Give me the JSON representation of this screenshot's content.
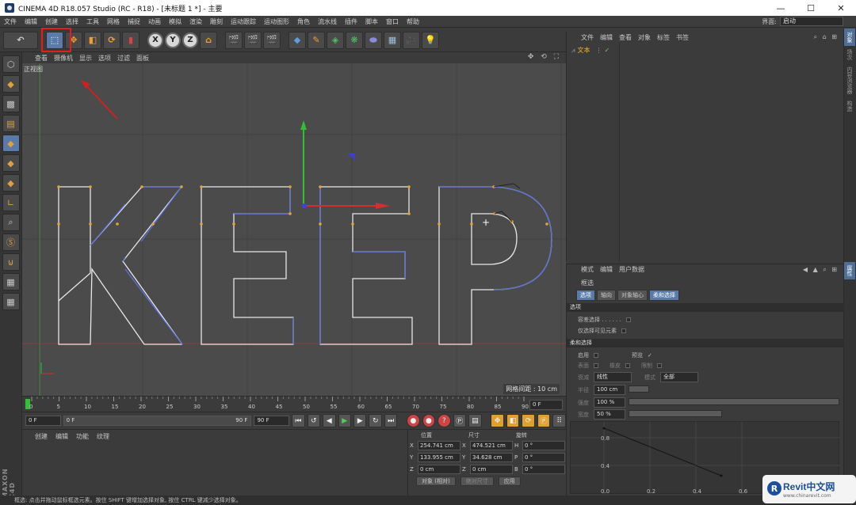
{
  "window": {
    "title": "CINEMA 4D R18.057 Studio (RC - R18) - [未标题 1 *] - 主要",
    "minimize": "—",
    "maximize": "☐",
    "close": "✕"
  },
  "menubar": {
    "items": [
      "文件",
      "编辑",
      "创建",
      "选择",
      "工具",
      "网格",
      "捕捉",
      "动画",
      "模拟",
      "渲染",
      "雕刻",
      "运动跟踪",
      "运动图形",
      "角色",
      "流水线",
      "插件",
      "脚本",
      "窗口",
      "帮助"
    ],
    "layout_label": "界面:",
    "layout_value": "启动"
  },
  "viewport": {
    "menu": [
      "查看",
      "摄像机",
      "显示",
      "选项",
      "过滤",
      "面板"
    ],
    "title": "正视图",
    "grid_note": "网格间距 : 10 cm",
    "icons": "✥ ⟲ ⛶"
  },
  "timeline": {
    "ticks": [
      "0",
      "5",
      "10",
      "15",
      "20",
      "25",
      "30",
      "35",
      "40",
      "45",
      "50",
      "55",
      "60",
      "65",
      "70",
      "75",
      "80",
      "85",
      "90"
    ],
    "current_frame": "0 F",
    "start": "0 F",
    "range_start": "0 F",
    "range_end": "90 F",
    "end": "90 F"
  },
  "material": {
    "tabs": [
      "创建",
      "编辑",
      "功能",
      "纹理"
    ]
  },
  "coords": {
    "headers": [
      "位置",
      "尺寸",
      "旋转"
    ],
    "rows": [
      {
        "a": "X",
        "pos": "254.741 cm",
        "b": "X",
        "size": "474.521 cm",
        "c": "H",
        "rot": "0 °"
      },
      {
        "a": "Y",
        "pos": "133.955 cm",
        "b": "Y",
        "size": "34.628 cm",
        "c": "P",
        "rot": "0 °"
      },
      {
        "a": "Z",
        "pos": "0 cm",
        "b": "Z",
        "size": "0 cm",
        "c": "B",
        "rot": "0 °"
      }
    ],
    "mode": "对象 (相对)",
    "size_mode": "绝对尺寸",
    "apply": "应用"
  },
  "status": {
    "text": "框选: 点击并拖动鼠标框选元素。按住 SHIFT 键增加选择对象, 按住 CTRL 键减少选择对象。"
  },
  "object_manager": {
    "menu": [
      "文件",
      "编辑",
      "查看",
      "对象",
      "标签",
      "书签"
    ],
    "object_name": "文本"
  },
  "side_tabs": [
    "对象",
    "场次",
    "内容浏览器",
    "构造"
  ],
  "attr_side_tab": "属性",
  "attributes": {
    "menu": [
      "模式",
      "编辑",
      "用户数据"
    ],
    "title": "框选",
    "tabs": [
      "选项",
      "轴向",
      "对象轴心",
      "柔和选择"
    ],
    "section_options": "选项",
    "tolerant": "容差选择 . . . . . .",
    "visible_only": "仅选择可见元素",
    "section_soft": "柔和选择",
    "enable": "启用",
    "preview": "预览",
    "preview_check": "✓",
    "surface": "表面",
    "rubber": "橡皮",
    "restrict": "限制",
    "mode_label": "衰减",
    "mode_value": "线性",
    "mode2_label": "模式",
    "mode2_value": "全部",
    "radius_label": "半径",
    "radius_value": "100 cm",
    "strength_label": "强度",
    "strength_value": "100 %",
    "width_label": "宽度",
    "width_value": "50 %",
    "graph_ticks_y": [
      "0.8",
      "0.4"
    ],
    "graph_ticks_x": [
      "0.0",
      "0.2",
      "0.4",
      "0.6"
    ]
  },
  "watermark": {
    "main": "Revit中文网",
    "sub": "www.chinarevit.com",
    "logo": "R"
  },
  "colors": {
    "accent": "#5a7aa8",
    "highlight_box": "#e02020",
    "spline_white": "#e8e8e8",
    "spline_selected": "#5a6fd8",
    "points": "#e6a23c"
  }
}
